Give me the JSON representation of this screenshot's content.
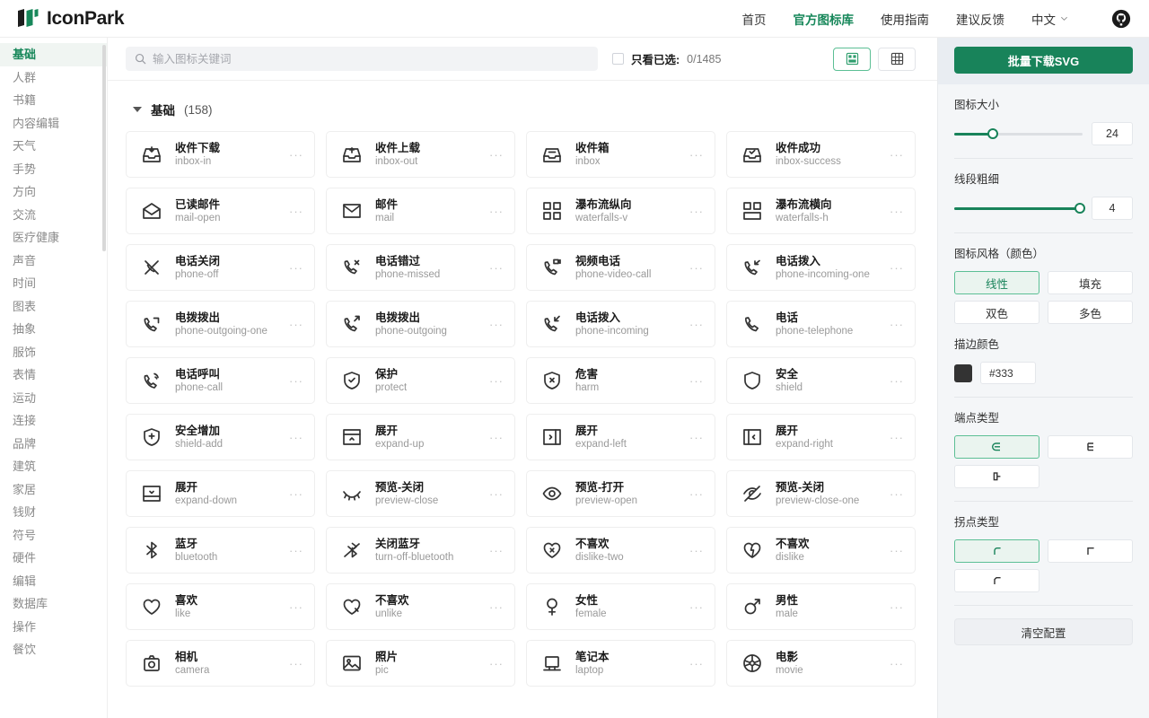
{
  "header": {
    "logo_text": "IconPark",
    "logo_icon": "iconpark-logo",
    "nav": [
      {
        "label": "首页",
        "active": false,
        "name": "nav-home"
      },
      {
        "label": "官方图标库",
        "active": true,
        "name": "nav-official-library"
      },
      {
        "label": "使用指南",
        "active": false,
        "name": "nav-guide"
      },
      {
        "label": "建议反馈",
        "active": false,
        "name": "nav-feedback"
      }
    ],
    "language": "中文",
    "language_icon": "chevron-down-icon",
    "github_icon": "github-icon"
  },
  "sidebar": {
    "items": [
      {
        "label": "基础",
        "active": true
      },
      {
        "label": "人群",
        "active": false
      },
      {
        "label": "书籍",
        "active": false
      },
      {
        "label": "内容编辑",
        "active": false
      },
      {
        "label": "天气",
        "active": false
      },
      {
        "label": "手势",
        "active": false
      },
      {
        "label": "方向",
        "active": false
      },
      {
        "label": "交流",
        "active": false
      },
      {
        "label": "医疗健康",
        "active": false
      },
      {
        "label": "声音",
        "active": false
      },
      {
        "label": "时间",
        "active": false
      },
      {
        "label": "图表",
        "active": false
      },
      {
        "label": "抽象",
        "active": false
      },
      {
        "label": "服饰",
        "active": false
      },
      {
        "label": "表情",
        "active": false
      },
      {
        "label": "运动",
        "active": false
      },
      {
        "label": "连接",
        "active": false
      },
      {
        "label": "品牌",
        "active": false
      },
      {
        "label": "建筑",
        "active": false
      },
      {
        "label": "家居",
        "active": false
      },
      {
        "label": "钱财",
        "active": false
      },
      {
        "label": "符号",
        "active": false
      },
      {
        "label": "硬件",
        "active": false
      },
      {
        "label": "编辑",
        "active": false
      },
      {
        "label": "数据库",
        "active": false
      },
      {
        "label": "操作",
        "active": false
      },
      {
        "label": "餐饮",
        "active": false
      }
    ]
  },
  "toolbar": {
    "search_placeholder": "输入图标关键词",
    "search_value": "",
    "search_icon": "search-icon",
    "only_selected_label": "只看已选:",
    "only_selected_count": "0/1485",
    "checkbox_checked": false,
    "view_modes": [
      {
        "name": "view-mode-compact",
        "icon": "grid-compact-icon",
        "active": true
      },
      {
        "name": "view-mode-dense",
        "icon": "grid-dense-icon",
        "active": false
      }
    ]
  },
  "section": {
    "title": "基础",
    "count": "(158)",
    "collapse_icon": "triangle-down-icon"
  },
  "icons": [
    {
      "cn": "收件下载",
      "en": "inbox-in",
      "icon": "inbox-in"
    },
    {
      "cn": "收件上载",
      "en": "inbox-out",
      "icon": "inbox-out"
    },
    {
      "cn": "收件箱",
      "en": "inbox",
      "icon": "inbox"
    },
    {
      "cn": "收件成功",
      "en": "inbox-success",
      "icon": "inbox-success"
    },
    {
      "cn": "已读邮件",
      "en": "mail-open",
      "icon": "mail-open"
    },
    {
      "cn": "邮件",
      "en": "mail",
      "icon": "mail"
    },
    {
      "cn": "瀑布流纵向",
      "en": "waterfalls-v",
      "icon": "waterfalls-v"
    },
    {
      "cn": "瀑布流横向",
      "en": "waterfalls-h",
      "icon": "waterfalls-h"
    },
    {
      "cn": "电话关闭",
      "en": "phone-off",
      "icon": "phone-off"
    },
    {
      "cn": "电话错过",
      "en": "phone-missed",
      "icon": "phone-missed"
    },
    {
      "cn": "视频电话",
      "en": "phone-video-call",
      "icon": "phone-video-call"
    },
    {
      "cn": "电话拨入",
      "en": "phone-incoming-one",
      "icon": "phone-incoming-one"
    },
    {
      "cn": "电拨拨出",
      "en": "phone-outgoing-one",
      "icon": "phone-outgoing-one"
    },
    {
      "cn": "电拨拨出",
      "en": "phone-outgoing",
      "icon": "phone-outgoing"
    },
    {
      "cn": "电话拨入",
      "en": "phone-incoming",
      "icon": "phone-incoming"
    },
    {
      "cn": "电话",
      "en": "phone-telephone",
      "icon": "phone-telephone"
    },
    {
      "cn": "电话呼叫",
      "en": "phone-call",
      "icon": "phone-call"
    },
    {
      "cn": "保护",
      "en": "protect",
      "icon": "protect"
    },
    {
      "cn": "危害",
      "en": "harm",
      "icon": "harm"
    },
    {
      "cn": "安全",
      "en": "shield",
      "icon": "shield"
    },
    {
      "cn": "安全增加",
      "en": "shield-add",
      "icon": "shield-add"
    },
    {
      "cn": "展开",
      "en": "expand-up",
      "icon": "expand-up"
    },
    {
      "cn": "展开",
      "en": "expand-left",
      "icon": "expand-left"
    },
    {
      "cn": "展开",
      "en": "expand-right",
      "icon": "expand-right"
    },
    {
      "cn": "展开",
      "en": "expand-down",
      "icon": "expand-down"
    },
    {
      "cn": "预览-关闭",
      "en": "preview-close",
      "icon": "preview-close"
    },
    {
      "cn": "预览-打开",
      "en": "preview-open",
      "icon": "preview-open"
    },
    {
      "cn": "预览-关闭",
      "en": "preview-close-one",
      "icon": "preview-close-one"
    },
    {
      "cn": "蓝牙",
      "en": "bluetooth",
      "icon": "bluetooth"
    },
    {
      "cn": "关闭蓝牙",
      "en": "turn-off-bluetooth",
      "icon": "turn-off-bluetooth"
    },
    {
      "cn": "不喜欢",
      "en": "dislike-two",
      "icon": "dislike-two"
    },
    {
      "cn": "不喜欢",
      "en": "dislike",
      "icon": "dislike"
    },
    {
      "cn": "喜欢",
      "en": "like",
      "icon": "like"
    },
    {
      "cn": "不喜欢",
      "en": "unlike",
      "icon": "unlike"
    },
    {
      "cn": "女性",
      "en": "female",
      "icon": "female"
    },
    {
      "cn": "男性",
      "en": "male",
      "icon": "male"
    },
    {
      "cn": "相机",
      "en": "camera",
      "icon": "camera"
    },
    {
      "cn": "照片",
      "en": "pic",
      "icon": "pic"
    },
    {
      "cn": "笔记本",
      "en": "laptop",
      "icon": "laptop"
    },
    {
      "cn": "电影",
      "en": "movie",
      "icon": "movie"
    }
  ],
  "card_more_label": "···",
  "config": {
    "download_button": "批量下载SVG",
    "size": {
      "label": "图标大小",
      "value": "24",
      "percent": 30
    },
    "stroke": {
      "label": "线段粗细",
      "value": "4",
      "percent": 98
    },
    "style": {
      "label": "图标风格（颜色）",
      "options": [
        {
          "label": "线性",
          "active": true
        },
        {
          "label": "填充",
          "active": false
        },
        {
          "label": "双色",
          "active": false
        },
        {
          "label": "多色",
          "active": false
        }
      ]
    },
    "stroke_color": {
      "label": "描边颜色",
      "value": "#333",
      "swatch": "#333333"
    },
    "linecap": {
      "label": "端点类型",
      "options": [
        {
          "icon": "linecap-round-icon",
          "active": true
        },
        {
          "icon": "linecap-butt-icon",
          "active": false
        },
        {
          "icon": "linecap-square-icon",
          "active": false
        }
      ]
    },
    "linejoin": {
      "label": "拐点类型",
      "options": [
        {
          "icon": "linejoin-round-icon",
          "active": true
        },
        {
          "icon": "linejoin-miter-icon",
          "active": false
        },
        {
          "icon": "linejoin-bevel-icon",
          "active": false
        }
      ]
    },
    "clear_button": "清空配置"
  },
  "colors": {
    "accent": "#18835a",
    "accent_light": "#eaf4ef",
    "accent_border": "#5cbf95",
    "panel_bg": "#f4f6f8",
    "text": "#333333"
  }
}
